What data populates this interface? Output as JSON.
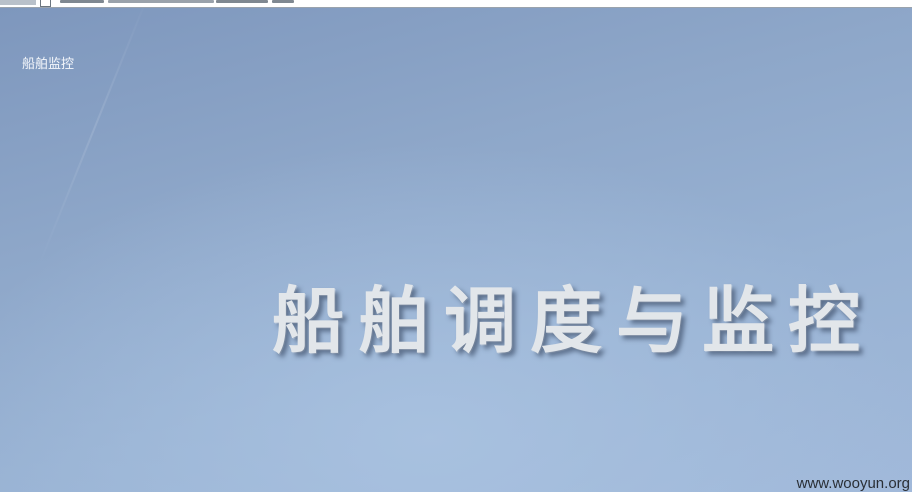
{
  "page": {
    "logo_text": "船舶监控",
    "hero_title": "船舶调度与监控"
  },
  "watermark": {
    "text": "www.wooyun.org"
  },
  "colors": {
    "background_top": "#7e97bd",
    "background_bottom": "#a1b9da",
    "hero_text": "#e2e6ea",
    "logo_text": "#f4f7fb"
  },
  "icons": {
    "address_bar_page_icon": "page-icon"
  }
}
